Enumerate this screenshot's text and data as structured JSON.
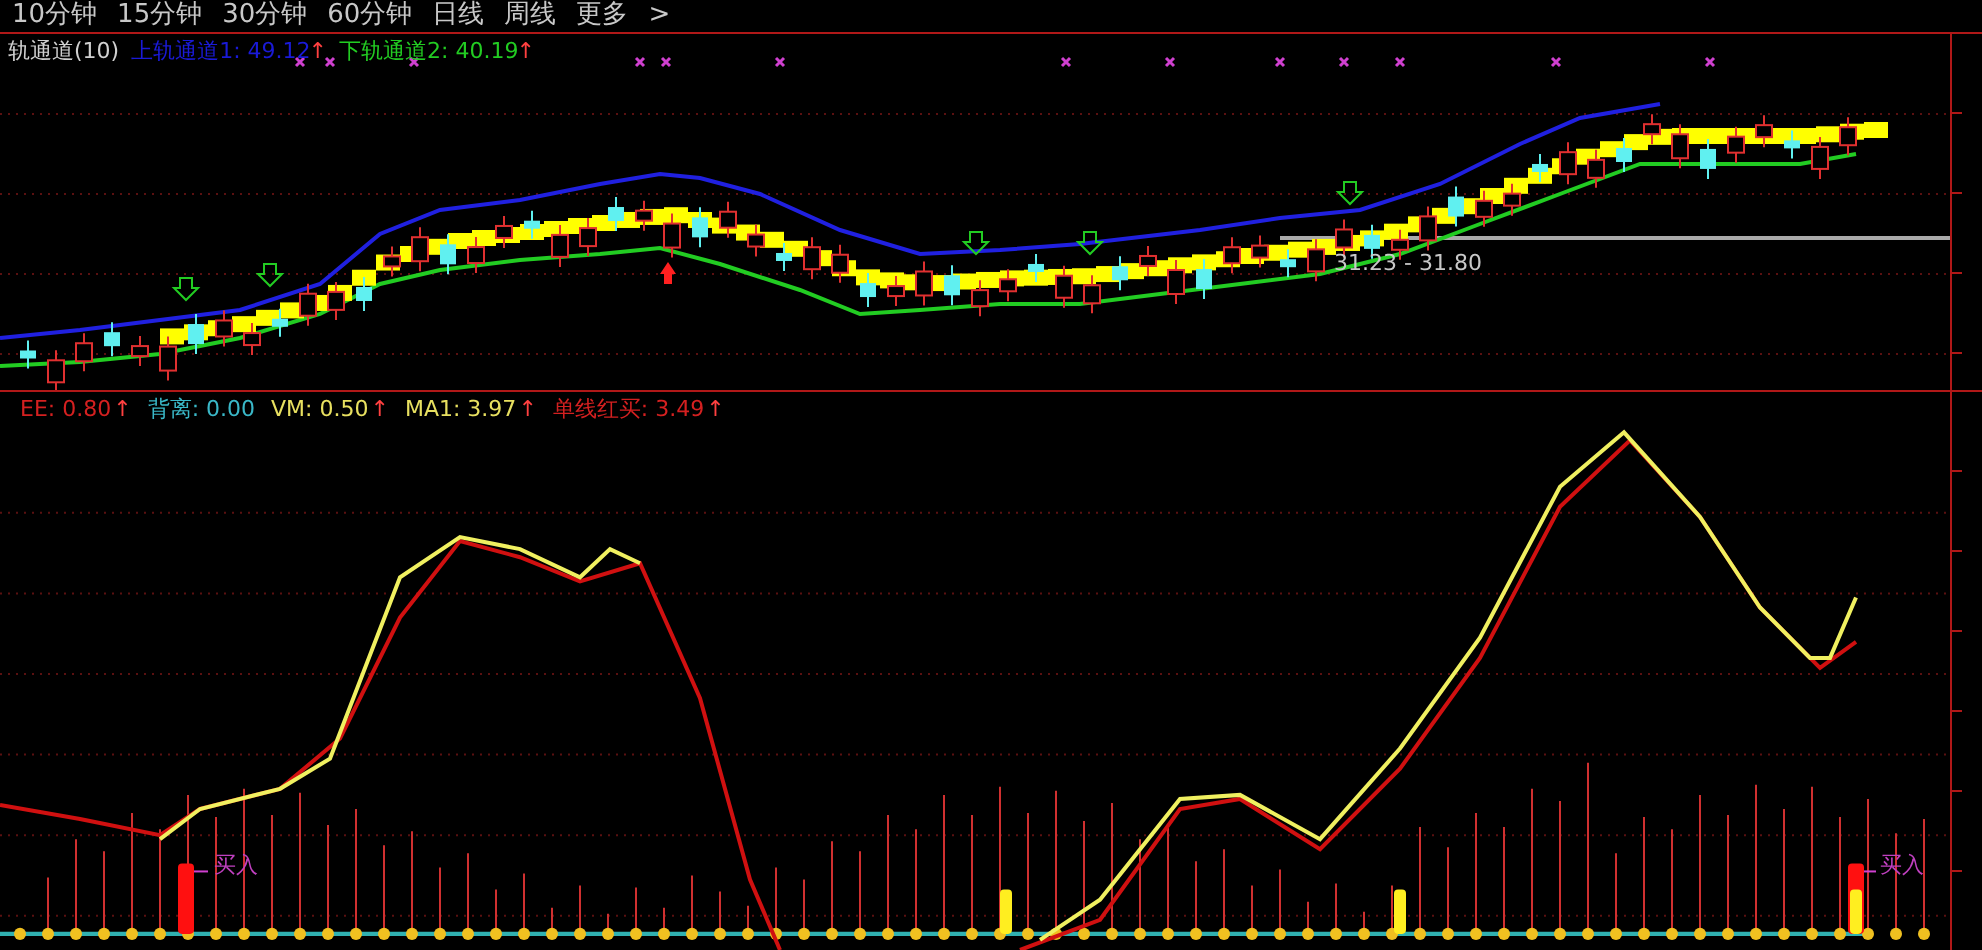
{
  "periods": [
    {
      "label": "10分钟"
    },
    {
      "label": "15分钟"
    },
    {
      "label": "30分钟"
    },
    {
      "label": "60分钟"
    },
    {
      "label": "日线"
    },
    {
      "label": "周线"
    },
    {
      "label": "更多"
    },
    {
      "label": ">"
    }
  ],
  "price_panel": {
    "title": "轨通道(10)",
    "legend": [
      {
        "label": "上轨通道1: 49.12",
        "arrow": "↑",
        "color": "#1a1ad8"
      },
      {
        "label": "下轨通道2: 40.19",
        "arrow": "↑",
        "color": "#22cc22"
      }
    ],
    "range_label": "31.23 - 31.80"
  },
  "indicator_panel": {
    "legend": [
      {
        "label": "EE: 0.80",
        "arrow": "↑",
        "color": "#d42020"
      },
      {
        "label": "背离: 0.00",
        "color": "#3ab8c8"
      },
      {
        "label": "VM: 0.50",
        "arrow": "↑",
        "color": "#e8e060"
      },
      {
        "label": "MA1: 3.97",
        "arrow": "↑",
        "color": "#e8e060"
      },
      {
        "label": "单线红买: 3.49",
        "arrow": "↑",
        "color": "#d42020"
      }
    ],
    "signals": [
      {
        "label": "买入"
      },
      {
        "label": "买入"
      }
    ]
  }
}
